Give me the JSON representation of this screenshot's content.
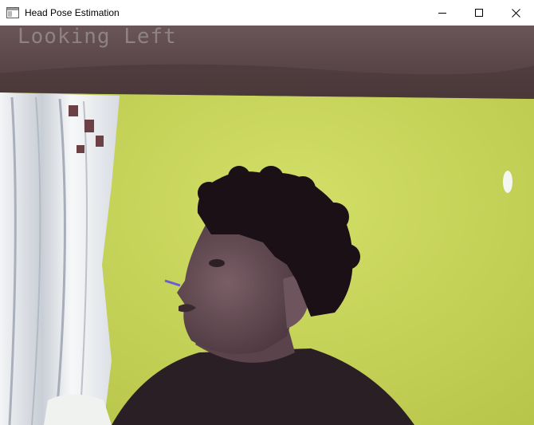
{
  "window": {
    "title": "Head Pose Estimation",
    "icon": "app-window-icon",
    "controls": [
      "minimize-icon",
      "maximize-icon",
      "close-icon"
    ]
  },
  "video": {
    "status_label": "Looking Left",
    "colors": {
      "ceiling": "#5e484a",
      "wall": "#c6d65a",
      "curtain": "#e7eaee",
      "hair": "#1a1016",
      "skin": "#6b5058",
      "shirt": "#2a1f24",
      "overlay_text": "#8d8386",
      "nose_line": "#6a5bd6"
    }
  }
}
